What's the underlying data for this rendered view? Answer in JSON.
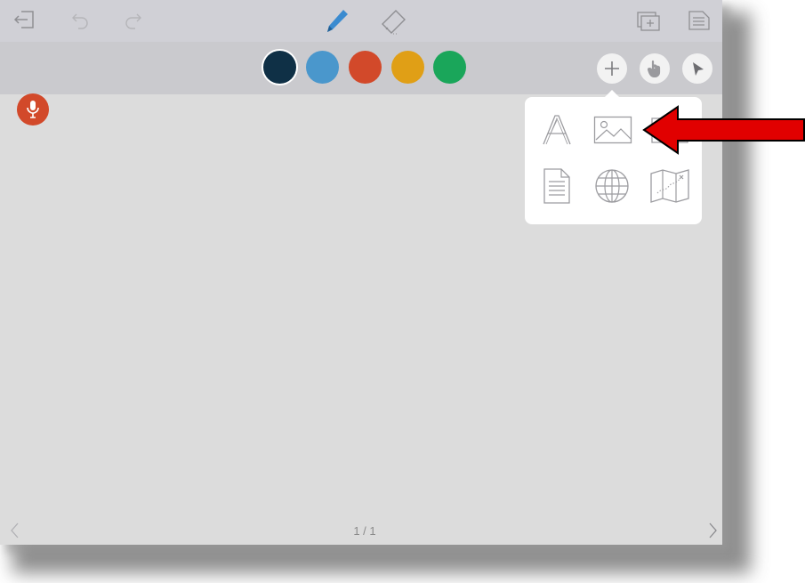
{
  "topbar": {
    "icons": [
      "exit-icon",
      "undo-icon",
      "redo-icon",
      "pen-icon",
      "eraser-icon",
      "add-page-icon",
      "notes-icon"
    ]
  },
  "toolbar": {
    "colors": [
      "#0f3046",
      "#4a97cc",
      "#d2492a",
      "#e09f16",
      "#1aa65a"
    ],
    "selected_color": "#0f3046",
    "mic_color": "#d2492a",
    "buttons": [
      "add-icon",
      "hand-icon",
      "pointer-icon"
    ]
  },
  "insert_menu": {
    "items": [
      "text-icon",
      "image-icon",
      "folder-icon",
      "document-icon",
      "web-icon",
      "map-icon"
    ]
  },
  "annotation": {
    "arrow_color": "#e10000"
  },
  "footer": {
    "page_indicator": "1 / 1"
  }
}
